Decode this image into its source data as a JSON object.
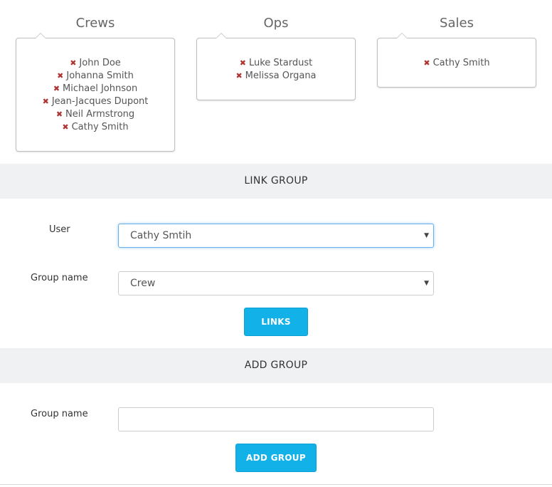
{
  "groups": [
    {
      "title": "Crews",
      "members": [
        "John Doe",
        "Johanna Smith",
        "Michael Johnson",
        "Jean-Jacques Dupont",
        "Neil Armstrong",
        "Cathy Smith"
      ]
    },
    {
      "title": "Ops",
      "members": [
        "Luke Stardust",
        "Melissa Organa"
      ]
    },
    {
      "title": "Sales",
      "members": [
        "Cathy Smith"
      ]
    }
  ],
  "remove_icon": "✖",
  "link_group": {
    "heading": "LINK GROUP",
    "user_label": "User",
    "user_value": "Cathy Smtih",
    "group_label": "Group name",
    "group_value": "Crew",
    "submit_label": "LINKS"
  },
  "add_group": {
    "heading": "ADD GROUP",
    "group_label": "Group name",
    "group_value": "",
    "submit_label": "ADD GROUP"
  },
  "colors": {
    "accent": "#12b2e8",
    "remove": "#b03333",
    "section_bg": "#eff1f2"
  }
}
